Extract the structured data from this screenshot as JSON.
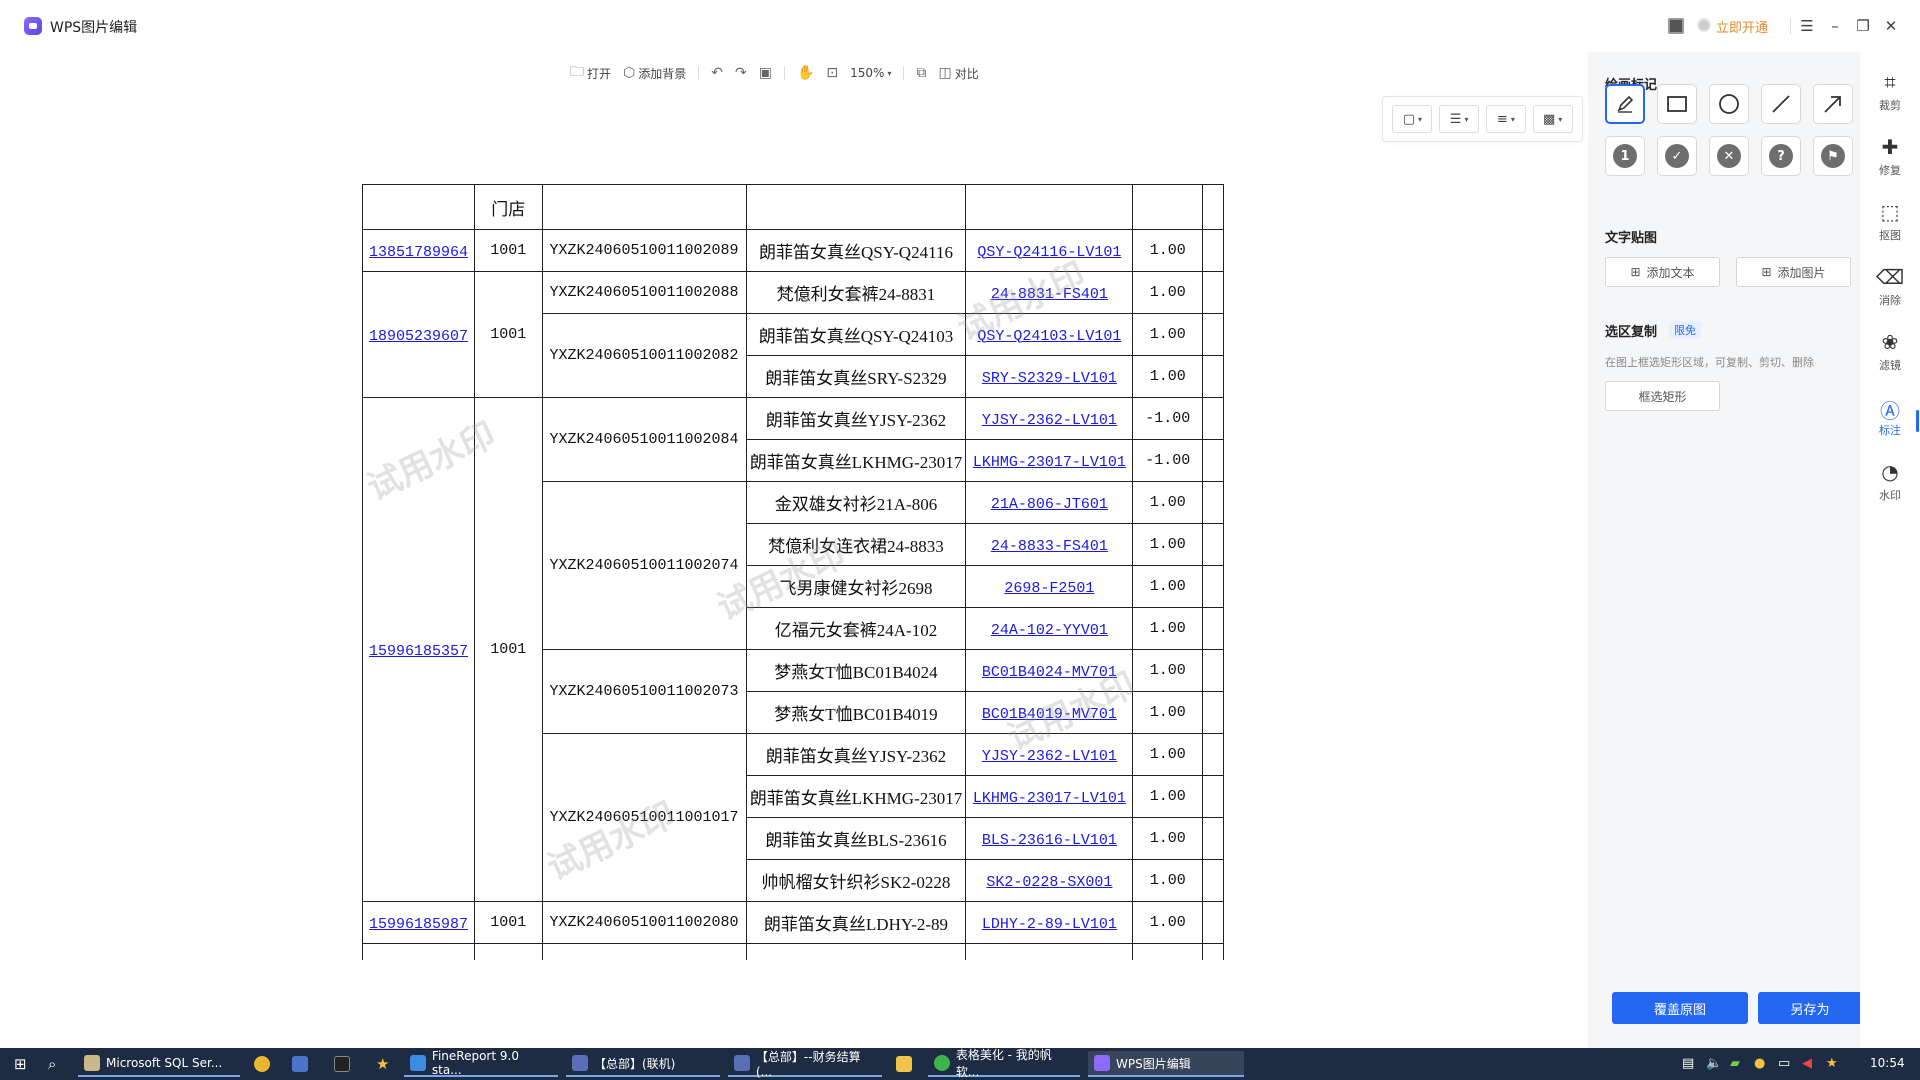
{
  "app": {
    "title": "WPS图片编辑",
    "open_now": "立即开通"
  },
  "toolbar": {
    "open": "打开",
    "add_background": "添加背景",
    "zoom": "150%",
    "compare": "对比"
  },
  "panel": {
    "draw_title": "绘画标记",
    "text_title": "文字贴图",
    "add_text": "添加文本",
    "add_image": "添加图片",
    "region_title": "选区复制",
    "free_tag": "限免",
    "region_desc": "在图上框选矩形区域，可复制、剪切、删除",
    "select_rect": "框选矩形",
    "overwrite": "覆盖原图",
    "save_as": "另存为"
  },
  "rail": {
    "crop": "裁剪",
    "repair": "修复",
    "cutout": "抠图",
    "erase": "消除",
    "filter": "滤镜",
    "annotate": "标注",
    "watermark": "水印"
  },
  "sheet": {
    "header_store": "门店",
    "watermark_text": "试用水印",
    "rows": [
      {
        "phone": "13851789964",
        "store": "1001",
        "order": "YXZK24060510011002089",
        "product": "朗菲笛女真丝QSY-Q24116",
        "code": "QSY-Q24116-LV101",
        "qty": "1.00"
      },
      {
        "phone": "",
        "store": "",
        "order": "YXZK24060510011002088",
        "product": "梵億利女套裤24-8831",
        "code": "24-8831-FS401",
        "qty": "1.00"
      },
      {
        "phone": "18905239607",
        "store": "1001",
        "order": "YXZK24060510011002082",
        "product": "朗菲笛女真丝QSY-Q24103",
        "code": "QSY-Q24103-LV101",
        "qty": "1.00"
      },
      {
        "phone": "",
        "store": "",
        "order": "",
        "product": "朗菲笛女真丝SRY-S2329",
        "code": "SRY-S2329-LV101",
        "qty": "1.00"
      },
      {
        "phone": "",
        "store": "",
        "order": "YXZK24060510011002084",
        "product": "朗菲笛女真丝YJSY-2362",
        "code": "YJSY-2362-LV101",
        "qty": "-1.00"
      },
      {
        "phone": "",
        "store": "",
        "order": "",
        "product": "朗菲笛女真丝LKHMG-23017",
        "code": "LKHMG-23017-LV101",
        "qty": "-1.00"
      },
      {
        "phone": "",
        "store": "",
        "order": "YXZK24060510011002074",
        "product": "金双雄女衬衫21A-806",
        "code": "21A-806-JT601",
        "qty": "1.00"
      },
      {
        "phone": "",
        "store": "",
        "order": "",
        "product": "梵億利女连衣裙24-8833",
        "code": "24-8833-FS401",
        "qty": "1.00"
      },
      {
        "phone": "",
        "store": "",
        "order": "",
        "product": "飞男康健女衬衫2698",
        "code": "2698-F2501",
        "qty": "1.00"
      },
      {
        "phone": "15996185357",
        "store": "1001",
        "order": "",
        "product": "亿福元女套裤24A-102",
        "code": "24A-102-YYV01",
        "qty": "1.00"
      },
      {
        "phone": "",
        "store": "",
        "order": "YXZK24060510011002073",
        "product": "梦燕女T恤BC01B4024",
        "code": "BC01B4024-MV701",
        "qty": "1.00"
      },
      {
        "phone": "",
        "store": "",
        "order": "",
        "product": "梦燕女T恤BC01B4019",
        "code": "BC01B4019-MV701",
        "qty": "1.00"
      },
      {
        "phone": "",
        "store": "",
        "order": "YXZK24060510011001017",
        "product": "朗菲笛女真丝YJSY-2362",
        "code": "YJSY-2362-LV101",
        "qty": "1.00"
      },
      {
        "phone": "",
        "store": "",
        "order": "",
        "product": "朗菲笛女真丝LKHMG-23017",
        "code": "LKHMG-23017-LV101",
        "qty": "1.00"
      },
      {
        "phone": "",
        "store": "",
        "order": "",
        "product": "朗菲笛女真丝BLS-23616",
        "code": "BLS-23616-LV101",
        "qty": "1.00"
      },
      {
        "phone": "",
        "store": "",
        "order": "",
        "product": "帅帆榴女针织衫SK2-0228",
        "code": "SK2-0228-SX001",
        "qty": "1.00"
      },
      {
        "phone": "15996185987",
        "store": "1001",
        "order": "YXZK24060510011002080",
        "product": "朗菲笛女真丝LDHY-2-89",
        "code": "LDHY-2-89-LV101",
        "qty": "1.00"
      }
    ]
  },
  "taskbar": {
    "items": [
      "Microsoft SQL Ser...",
      "FineReport 9.0 sta...",
      "【总部】(联机)",
      "【总部】--财务结算(...",
      "表格美化 - 我的帆软...",
      "WPS图片编辑"
    ],
    "clock": "10:54"
  },
  "colors": {
    "accent": "#2468f2",
    "link": "#1a1ae6",
    "vip": "#e68b2a",
    "taskbar": "#1d2b43"
  }
}
